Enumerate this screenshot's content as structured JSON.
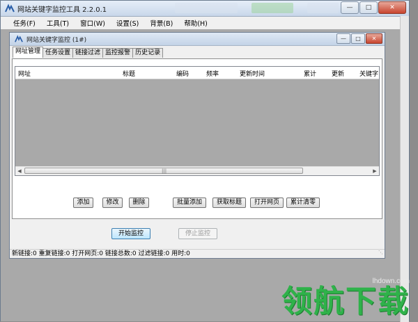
{
  "app": {
    "title": "网站关键字监控工具 2.2.0.1"
  },
  "menu": [
    "任务(F)",
    "工具(T)",
    "窗口(W)",
    "设置(S)",
    "背景(B)",
    "帮助(H)"
  ],
  "child_window": {
    "title": "网站关键字监控 (1#)"
  },
  "tabs": [
    "网址管理",
    "任务设置",
    "链接过滤",
    "监控报警",
    "历史记录"
  ],
  "active_tab": "网址管理",
  "grid": {
    "columns": [
      "网址",
      "标题",
      "编码",
      "频率",
      "更新时间",
      "累计",
      "更新",
      "关键字"
    ],
    "rows": []
  },
  "action_buttons": {
    "add": "添加",
    "edit": "修改",
    "delete": "删除",
    "batch_add": "批量添加",
    "fetch_title": "获取标题",
    "open_page": "打开网页",
    "clear_total": "累计清零"
  },
  "control_buttons": {
    "start": "开始监控",
    "stop": "停止监控"
  },
  "status": "新链接:0 重复链接:0 打开网页:0 链接总数:0 过滤链接:0 用时:0",
  "watermark": {
    "url": "lhdown.com",
    "logo": "领航下载"
  },
  "colors": {
    "mdi_background": "#a9a9a9",
    "watermark_green": "#2fb24a",
    "close_red": "#c8442e"
  }
}
